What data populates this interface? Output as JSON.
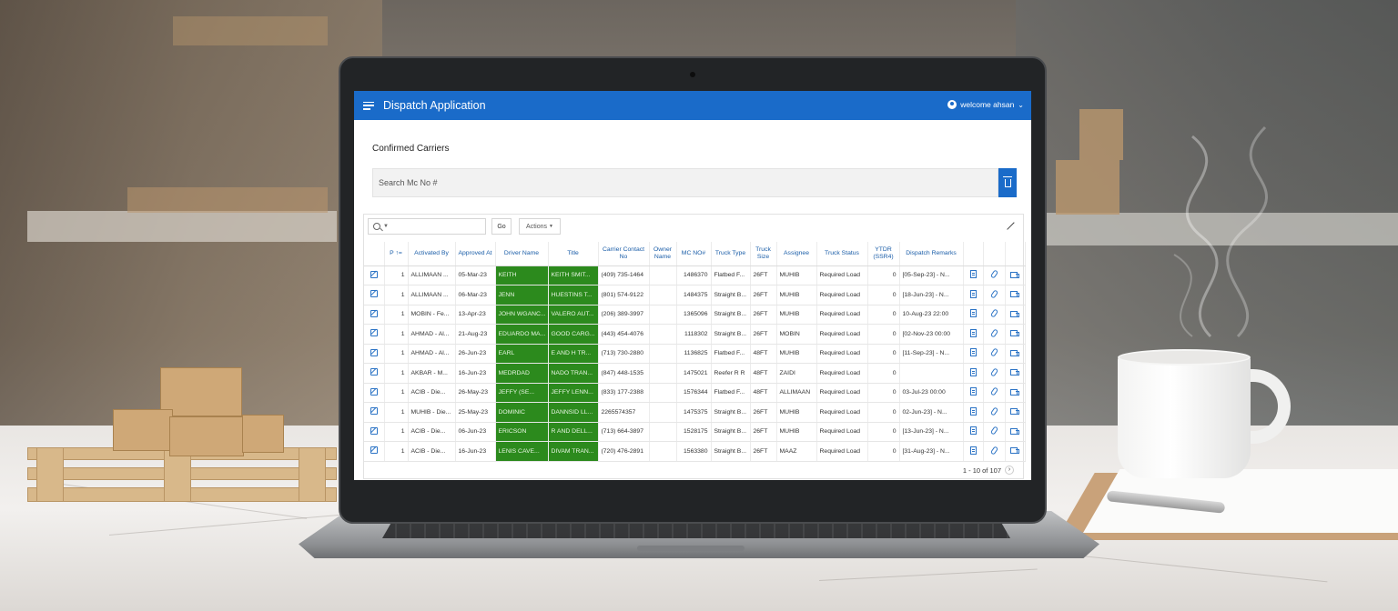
{
  "app": {
    "title": "Dispatch Application",
    "user_label": "welcome ahsan"
  },
  "region": {
    "title": "Confirmed Carriers"
  },
  "search": {
    "value": "Search Mc No #"
  },
  "report": {
    "go_label": "Go",
    "actions_label": "Actions",
    "pagination": "1 - 10 of 107"
  },
  "table": {
    "columns": [
      "",
      "P ↑=",
      "Activated By",
      "Approved At",
      "Driver Name",
      "Title",
      "Carrier Contact No",
      "Owner Name",
      "MC NO#",
      "Truck Type",
      "Truck Size",
      "Assignee",
      "Truck Status",
      "YTDR (SSR4)",
      "Dispatch Remarks",
      "",
      "",
      ""
    ],
    "rows": [
      [
        "1",
        "ALLIMAAN ...",
        "05-Mar-23",
        "KEITH",
        "KEITH SMIT...",
        "(409) 735-1464",
        "",
        "1486370",
        "Flatbed F...",
        "26FT",
        "MUHIB",
        "Required Load",
        "0",
        "[05-Sep-23] - N..."
      ],
      [
        "1",
        "ALLIMAAN ...",
        "06-Mar-23",
        "JENN",
        "HUESTINS T...",
        "(801) 574-9122",
        "",
        "1484375",
        "Straight B...",
        "26FT",
        "MUHIB",
        "Required Load",
        "0",
        "[18-Jun-23] - N..."
      ],
      [
        "1",
        "MOBIN - Fe...",
        "13-Apr-23",
        "JOHN WGANC...",
        "VALERO AUT...",
        "(206) 389-3997",
        "",
        "1365096",
        "Straight B...",
        "26FT",
        "MUHIB",
        "Required Load",
        "0",
        "10-Aug-23 22:00"
      ],
      [
        "1",
        "AHMAD - Al...",
        "21-Aug-23",
        "EDUARDO MA...",
        "GOOD CARG...",
        "(443) 454-4076",
        "",
        "1118302",
        "Straight B...",
        "26FT",
        "MOBIN",
        "Required Load",
        "0",
        "[02-Nov-23 00:00"
      ],
      [
        "1",
        "AHMAD - Al...",
        "26-Jun-23",
        "EARL",
        "E AND H TR...",
        "(713) 730-2880",
        "",
        "1136825",
        "Flatbed F...",
        "48FT",
        "MUHIB",
        "Required Load",
        "0",
        "[11-Sep-23] - N..."
      ],
      [
        "1",
        "AKBAR - M...",
        "16-Jun-23",
        "MEDRDAD",
        "NADO TRAN...",
        "(847) 448-1535",
        "",
        "1475021",
        "Reefer R R",
        "48FT",
        "ZAIDI",
        "Required Load",
        "0",
        ""
      ],
      [
        "1",
        "ACIB - Die...",
        "26-May-23",
        "JEFFY (SE...",
        "JEFFY LENN...",
        "(833) 177-2388",
        "",
        "1576344",
        "Flatbed F...",
        "48FT",
        "ALLIMAAN",
        "Required Load",
        "0",
        "03-Jul-23 00:00"
      ],
      [
        "1",
        "MUHIB - Die...",
        "25-May-23",
        "DOMINIC",
        "DANNSID LL...",
        "2265574357",
        "",
        "1475375",
        "Straight B...",
        "26FT",
        "MUHIB",
        "Required Load",
        "0",
        "02-Jun-23] - N..."
      ],
      [
        "1",
        "ACIB - Die...",
        "06-Jun-23",
        "ERICSON",
        "R AND DELL...",
        "(713) 664-3897",
        "",
        "1528175",
        "Straight B...",
        "26FT",
        "MUHIB",
        "Required Load",
        "0",
        "[13-Jun-23] - N..."
      ],
      [
        "1",
        "ACIB - Die...",
        "16-Jun-23",
        "LENIS CAVE...",
        "DIVAM TRAN...",
        "(720) 476-2891",
        "",
        "1563380",
        "Straight B...",
        "26FT",
        "MAAZ",
        "Required Load",
        "0",
        "[31-Aug-23] - N..."
      ]
    ]
  },
  "colors": {
    "header_blue": "#1a6bc9",
    "link_blue": "#1a5da8",
    "highlight_green": "#2c8a1d"
  },
  "icons": {
    "menu": "hamburger-icon",
    "user": "user-icon",
    "delete": "trash-icon",
    "search": "search-icon",
    "expand": "expand-icon",
    "edit": "edit-icon",
    "document": "document-icon",
    "attachment": "paperclip-icon",
    "dispatch": "truck-icon"
  }
}
